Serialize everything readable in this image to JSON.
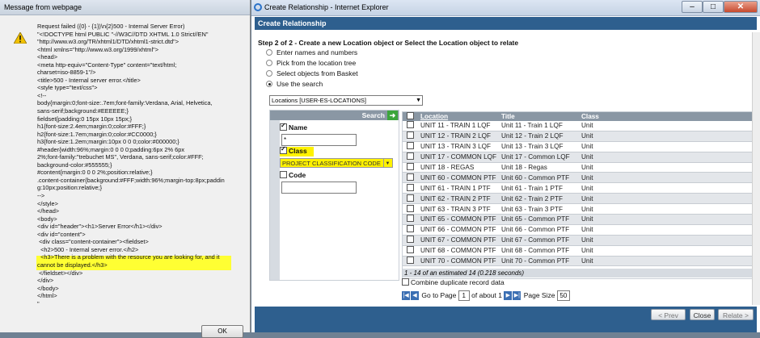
{
  "message_dialog": {
    "title": "Message from webpage",
    "lines": "Request failed ({0} - {1})\\n{2}500 - Internal Server Error)\n\"<!DOCTYPE html PUBLIC \"-//W3C//DTD XHTML 1.0 Strict//EN\"\n\"http://www.w3.org/TR/xhtml1/DTD/xhtml1-strict.dtd\">\n<html xmlns=\"http://www.w3.org/1999/xhtml\">\n<head>\n<meta http-equiv=\"Content-Type\" content=\"text/html;\ncharset=iso-8859-1\"/>\n<title>500 - Internal server error.</title>\n<style type=\"text/css\">\n<!--\nbody{margin:0;font-size:.7em;font-family:Verdana, Arial, Helvetica,\nsans-serif;background:#EEEEEE;}\nfieldset{padding:0 15px 10px 15px;}\nh1{font-size:2.4em;margin:0;color:#FFF;}\nh2{font-size:1.7em;margin:0;color:#CC0000;}\nh3{font-size:1.2em;margin:10px 0 0 0;color:#000000;}\n#header{width:96%;margin:0 0 0 0;padding:6px 2% 6px\n2%;font-family:\"trebuchet MS\", Verdana, sans-serif;color:#FFF;\nbackground-color:#555555;}\n#content{margin:0 0 0 2%;position:relative;}\n.content-container{background:#FFF;width:96%;margin-top:8px;paddin\ng:10px;position:relative;}\n-->\n</style>\n</head>\n<body>\n<div id=\"header\"><h1>Server Error</h1></div>\n<div id=\"content\">\n <div class=\"content-container\"><fieldset>\n  <h2>500 - Internal server error.</h2>\n  <h3>There is a problem with the resource you are looking for, and it\ncannot be displayed.</h3>\n </fieldset></div>\n</div>\n</body>\n</html>\n\"",
    "ok_label": "OK"
  },
  "ie_window": {
    "title": "Create Relationship - Internet Explorer",
    "header": "Create Relationship",
    "step_title": "Step 2 of 2 - Create a new Location object or Select the Location object to relate",
    "radio_options": [
      {
        "label": "Enter names and numbers",
        "selected": false
      },
      {
        "label": "Pick from the location tree",
        "selected": false
      },
      {
        "label": "Select objects from Basket",
        "selected": false
      },
      {
        "label": "Use the search",
        "selected": true
      }
    ],
    "location_select": "Locations [USER-ES-LOCATIONS]",
    "search": {
      "button_label": "Search",
      "name_label": "Name",
      "name_checked": true,
      "name_value": "*",
      "class_label": "Class",
      "class_checked": true,
      "class_value": "PROJECT CLASSIFICATION CODE",
      "code_label": "Code",
      "code_checked": false,
      "code_value": ""
    },
    "results": {
      "columns": [
        "Location",
        "Title",
        "Class"
      ],
      "rows": [
        [
          "UNIT 11 - TRAIN 1 LQF",
          "Unit 11 - Train 1 LQF",
          "Unit"
        ],
        [
          "UNIT 12 - TRAIN 2 LQF",
          "Unit 12 - Train 2 LQF",
          "Unit"
        ],
        [
          "UNIT 13 - TRAIN 3 LQF",
          "Unit 13 - Train 3 LQF",
          "Unit"
        ],
        [
          "UNIT 17 - COMMON LQF",
          "Unit 17 - Common LQF",
          "Unit"
        ],
        [
          "UNIT 18 - REGAS",
          "Unit 18 - Regas",
          "Unit"
        ],
        [
          "UNIT 60 - COMMON PTF",
          "Unit 60 - Common PTF",
          "Unit"
        ],
        [
          "UNIT 61 - TRAIN 1 PTF",
          "Unit 61 - Train 1 PTF",
          "Unit"
        ],
        [
          "UNIT 62 - TRAIN 2 PTF",
          "Unit 62 - Train 2 PTF",
          "Unit"
        ],
        [
          "UNIT 63 - TRAIN 3 PTF",
          "Unit 63 - Train 3 PTF",
          "Unit"
        ],
        [
          "UNIT 65 - COMMON PTF",
          "Unit 65 - Common PTF",
          "Unit"
        ],
        [
          "UNIT 66 - COMMON PTF",
          "Unit 66 - Common PTF",
          "Unit"
        ],
        [
          "UNIT 67 - COMMON PTF",
          "Unit 67 - Common PTF",
          "Unit"
        ],
        [
          "UNIT 68 - COMMON PTF",
          "Unit 68 - Common PTF",
          "Unit"
        ],
        [
          "UNIT 70 - COMMON PTF",
          "Unit 70 - Common PTF",
          "Unit"
        ]
      ],
      "footer": "1 - 14 of an estimated 14 (0.218 seconds)"
    },
    "combine_label": "Combine duplicate record data",
    "pager": {
      "go_to_page": "Go to Page",
      "page": "1",
      "of_about": "of about 1",
      "page_size_label": "Page Size",
      "page_size": "50"
    },
    "buttons": {
      "prev": "< Prev",
      "close": "Close",
      "relate": "Relate >"
    }
  }
}
